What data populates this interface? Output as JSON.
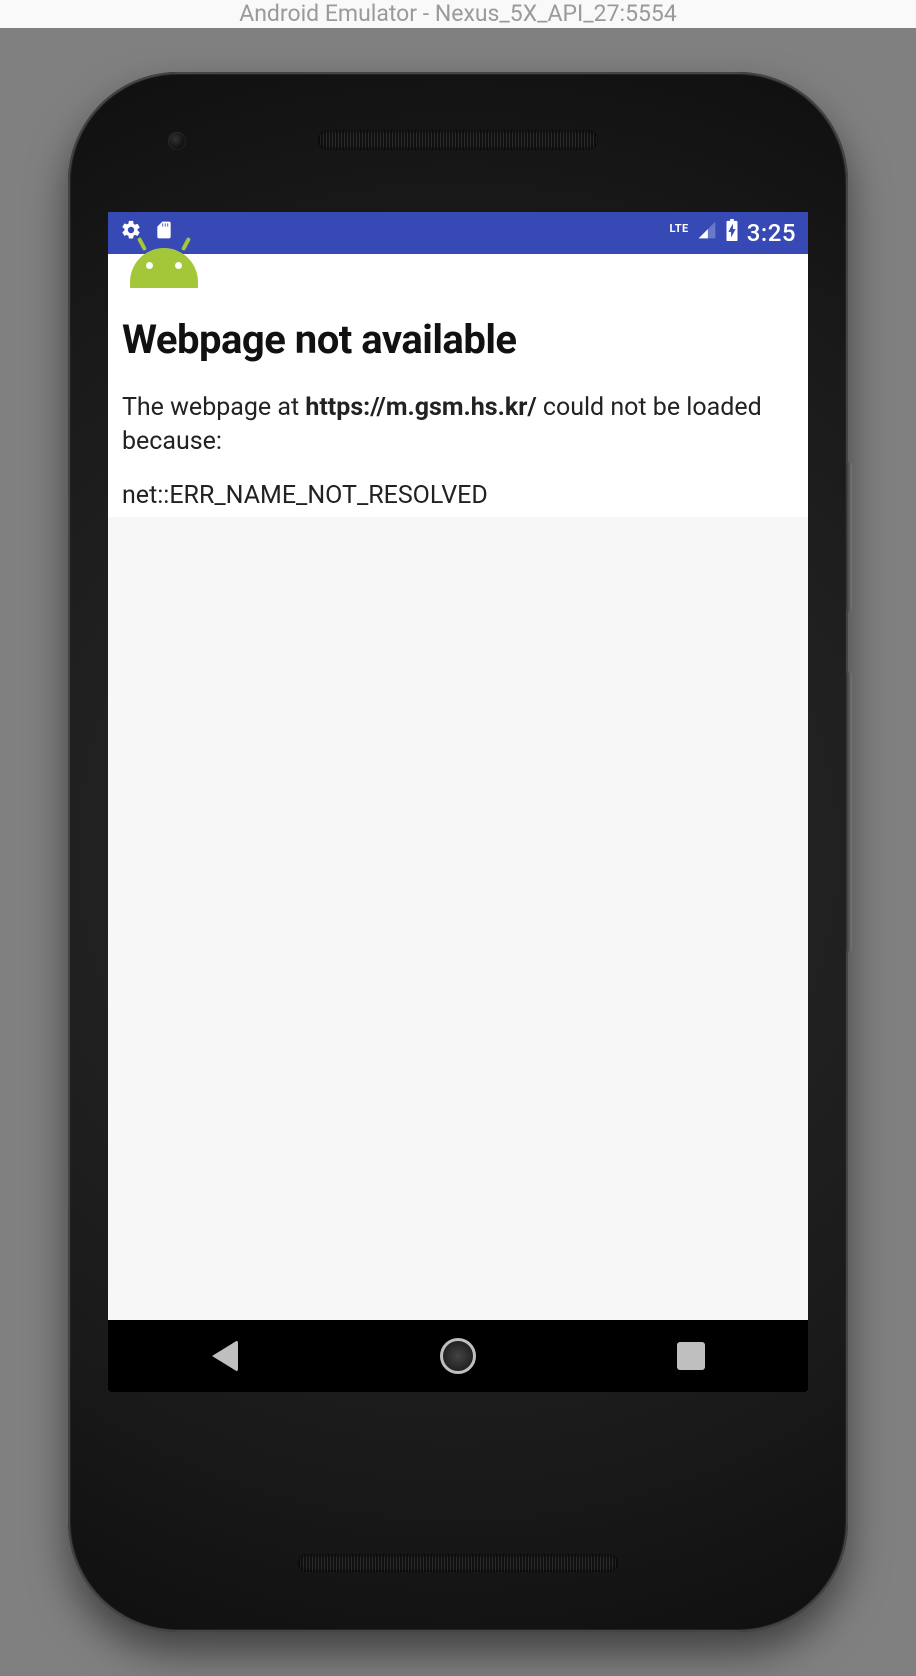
{
  "window": {
    "title": "Android Emulator - Nexus_5X_API_27:5554"
  },
  "status_bar": {
    "network_label": "LTE",
    "clock": "3:25"
  },
  "error_page": {
    "title": "Webpage not available",
    "message_prefix": "The webpage at ",
    "url": "https://m.gsm.hs.kr/",
    "message_suffix": " could not be loaded because:",
    "error_code": "net::ERR_NAME_NOT_RESOLVED"
  }
}
